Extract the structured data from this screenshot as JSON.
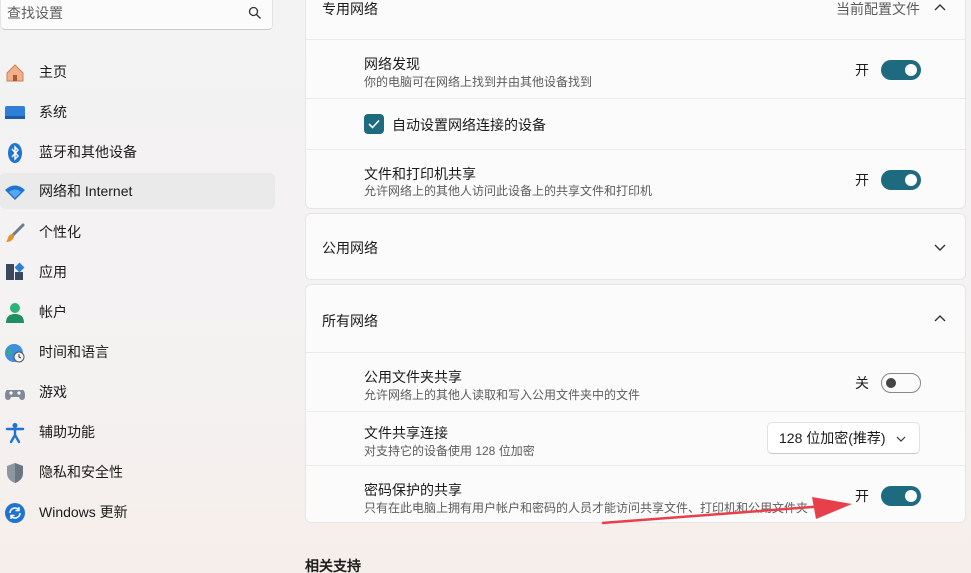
{
  "search": {
    "placeholder": "查找设置"
  },
  "sidebar": {
    "items": [
      {
        "label": "主页",
        "icon": "home-icon"
      },
      {
        "label": "系统",
        "icon": "display-icon"
      },
      {
        "label": "蓝牙和其他设备",
        "icon": "bluetooth-icon"
      },
      {
        "label": "网络和 Internet",
        "icon": "wifi-icon",
        "active": true
      },
      {
        "label": "个性化",
        "icon": "brush-icon"
      },
      {
        "label": "应用",
        "icon": "apps-icon"
      },
      {
        "label": "帐户",
        "icon": "person-icon"
      },
      {
        "label": "时间和语言",
        "icon": "globe-clock-icon"
      },
      {
        "label": "游戏",
        "icon": "gamepad-icon"
      },
      {
        "label": "辅助功能",
        "icon": "accessibility-icon"
      },
      {
        "label": "隐私和安全性",
        "icon": "shield-icon"
      },
      {
        "label": "Windows 更新",
        "icon": "update-icon"
      }
    ]
  },
  "private_network": {
    "title": "专用网络",
    "current_profile": "当前配置文件",
    "network_discovery": {
      "title": "网络发现",
      "subtitle": "你的电脑可在网络上找到并由其他设备找到",
      "state": "开"
    },
    "auto_setup": {
      "label": "自动设置网络连接的设备",
      "checked": true
    },
    "file_printer_sharing": {
      "title": "文件和打印机共享",
      "subtitle": "允许网络上的其他人访问此设备上的共享文件和打印机",
      "state": "开"
    }
  },
  "public_network": {
    "title": "公用网络"
  },
  "all_networks": {
    "title": "所有网络",
    "public_folder_sharing": {
      "title": "公用文件夹共享",
      "subtitle": "允许网络上的其他人读取和写入公用文件夹中的文件",
      "state": "关"
    },
    "file_sharing_connection": {
      "title": "文件共享连接",
      "subtitle": "对支持它的设备使用 128 位加密",
      "selected": "128 位加密(推荐)"
    },
    "password_protected_sharing": {
      "title": "密码保护的共享",
      "subtitle": "只有在此电脑上拥有用户帐户和密码的人员才能访问共享文件、打印机和公用文件夹",
      "state": "开"
    }
  },
  "related_support": {
    "title": "相关支持"
  },
  "colors": {
    "accent": "#1e6a7e",
    "annotation_arrow": "#e8404a"
  }
}
